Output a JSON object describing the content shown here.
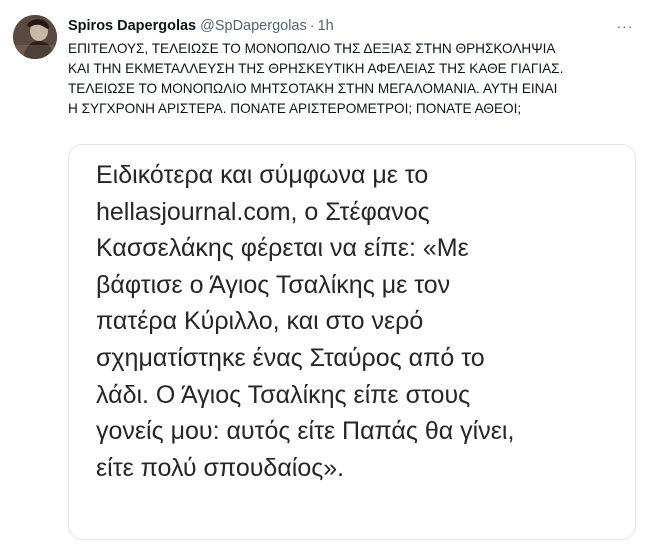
{
  "tweet": {
    "display_name": "Spiros Dapergolas",
    "handle": "@SpDapergolas",
    "separator": "·",
    "time": "1h",
    "more_label": "···",
    "text": "ΕΠΙΤΕΛΟΥΣ, ΤΕΛΕΙΩΣΕ ΤΟ ΜΟΝΟΠΩΛΙΟ ΤΗΣ ΔΕΞΙΑΣ ΣΤΗΝ ΘΡΗΣΚΟΛΗΨΙΑ\nΚΑΙ ΤΗΝ ΕΚΜΕΤΑΛΛΕΥΣΗ ΤΗΣ ΘΡΗΣΚΕΥΤΙΚΗ ΑΦΕΛΕΙΑΣ ΤΗΣ ΚΑΘΕ ΓΙΑΓΙΑΣ.\nΤΕΛΕΙΩΣΕ ΤΟ ΜΟΝΟΠΩΛΙΟ ΜΗΤΣΟΤΑΚΗ ΣΤΗΝ ΜΕΓΑΛΟΜΑΝΙΑ. ΑΥΤΗ ΕΙΝΑΙ\nΗ ΣΥΓΧΡΟΝΗ ΑΡΙΣΤΕΡΑ. ΠΟΝΑΤΕ ΑΡΙΣΤΕΡΟΜΕΤΡΟΙ; ΠΟΝΑΤΕ ΑΘΕΟΙ;"
  },
  "quote": {
    "text": "Ειδικότερα και σύμφωνα με το\nhellasjournal.com, ο Στέφανος\nΚασσελάκης φέρεται να είπε: «Με\nβάφτισε ο Άγιος Τσαλίκης με τον\nπατέρα Κύριλλο, και στο νερό\nσχηματίστηκε ένας Σταύρος από το\nλάδι. Ο Άγιος Τσαλίκης είπε στους\nγονείς μου: αυτός είτε Παπάς θα γίνει,\nείτε πολύ σπουδαίος»."
  },
  "colors": {
    "name": "#0f1419",
    "secondary": "#536471",
    "card_border": "#e3e6e8",
    "quote_text": "#262626"
  },
  "icons": {
    "avatar": "avatar-photo",
    "more": "more-options-icon"
  }
}
